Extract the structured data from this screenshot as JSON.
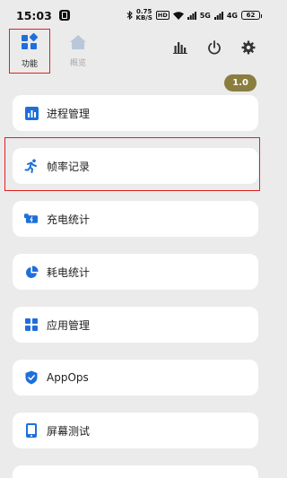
{
  "status_bar": {
    "time": "15:03",
    "speed_value": "0.75",
    "speed_unit": "KB/S",
    "hd_label": "HD",
    "net1": "5G",
    "net2": "4G",
    "battery": "62"
  },
  "nav": {
    "tabs": [
      {
        "label": "功能",
        "active": true
      },
      {
        "label": "概览",
        "active": false
      }
    ],
    "icons": [
      "bar-chart-icon",
      "power-icon",
      "gear-icon"
    ]
  },
  "version_badge": "1.0",
  "menu": {
    "items": [
      {
        "label": "进程管理",
        "icon": "process-chart-icon"
      },
      {
        "label": "帧率记录",
        "icon": "running-person-icon"
      },
      {
        "label": "充电统计",
        "icon": "charging-battery-icon"
      },
      {
        "label": "耗电统计",
        "icon": "pie-chart-icon"
      },
      {
        "label": "应用管理",
        "icon": "app-grid-icon"
      },
      {
        "label": "AppOps",
        "icon": "shield-check-icon"
      },
      {
        "label": "屏幕测试",
        "icon": "phone-screen-icon"
      }
    ]
  },
  "colors": {
    "accent": "#1e6fd9",
    "highlight": "#e02020",
    "badge": "#8a7d3e",
    "background": "#ebebeb"
  }
}
